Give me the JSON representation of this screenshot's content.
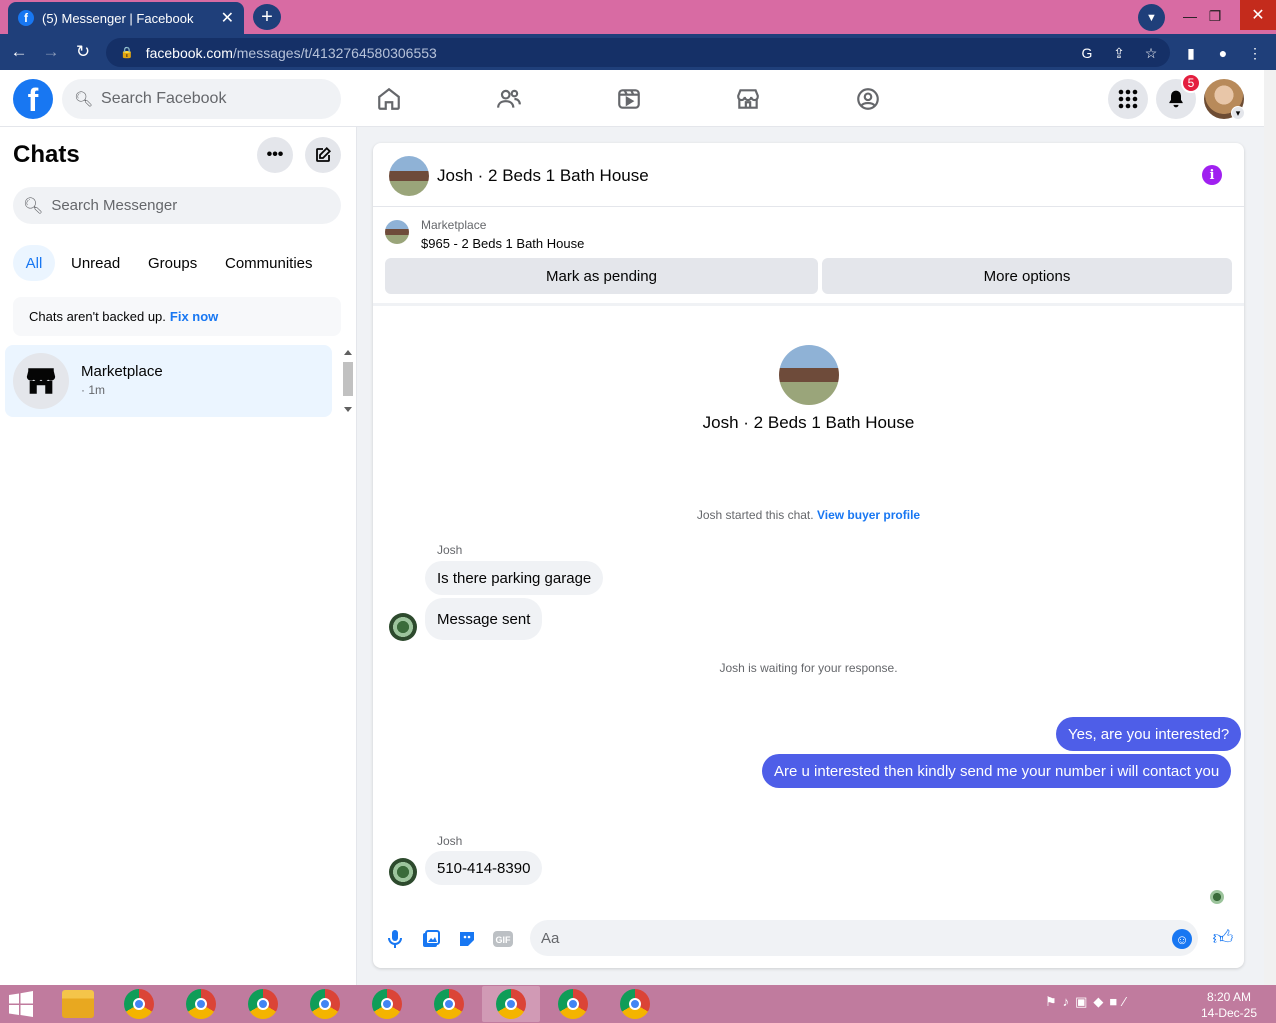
{
  "browser": {
    "tab_title": "(5) Messenger | Facebook",
    "tab_close": "✕",
    "new_tab": "+",
    "url_domain": "facebook.com",
    "url_path": "/messages/t/4132764580306553"
  },
  "fb": {
    "logo": "f",
    "search_placeholder": "Search Facebook",
    "notifications_count": "5",
    "nav_icons": [
      "home-icon",
      "friends-icon",
      "video-icon",
      "marketplace-icon",
      "groups-icon"
    ]
  },
  "sidebar": {
    "title": "Chats",
    "search_placeholder": "Search Messenger",
    "filters": [
      "All",
      "Unread",
      "Groups",
      "Communities"
    ],
    "active_filter": "All",
    "backup_text": "Chats aren't backed up.",
    "backup_link": "Fix now",
    "chats": [
      {
        "name": "Marketplace",
        "time": "· 1m"
      }
    ]
  },
  "conversation": {
    "title": "Josh · 2 Beds 1 Bath House",
    "marketplace_label": "Marketplace",
    "listing": "$965 - 2 Beds 1 Bath House",
    "mark_pending": "Mark as pending",
    "more_options": "More options",
    "profile_name": "Josh · 2 Beds 1 Bath House",
    "started_text": "Josh started this chat.",
    "started_link": "View buyer profile",
    "waiting_text": "Josh is waiting for your response.",
    "messages": [
      {
        "sender": "Josh",
        "text": "Is there parking garage"
      },
      {
        "sender": "",
        "text": "Message sent"
      },
      {
        "sender": "me",
        "text": "Yes, are you interested?"
      },
      {
        "sender": "me",
        "text": "Are u interested then kindly send me your number i will contact you"
      },
      {
        "sender": "Josh",
        "text": "510-414-8390"
      }
    ],
    "composer_placeholder": "Aa"
  },
  "taskbar": {
    "time": "8:20 AM",
    "date": "14-Dec-25"
  }
}
